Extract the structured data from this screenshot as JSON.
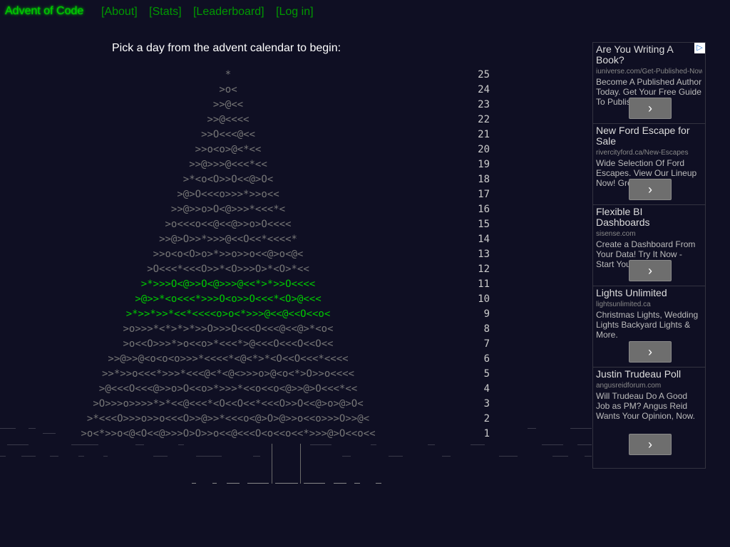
{
  "header": {
    "title": "Advent of Code",
    "nav": [
      "[About]",
      "[Stats]",
      "[Leaderboard]",
      "[Log in]"
    ]
  },
  "intro": "Pick a day from the advent calendar to begin:",
  "tree": [
    {
      "art": "*",
      "day": "25",
      "lit": false
    },
    {
      "art": ">o<",
      "day": "24",
      "lit": false
    },
    {
      "art": ">>@<<",
      "day": "23",
      "lit": false
    },
    {
      "art": ">>@<<<<",
      "day": "22",
      "lit": false
    },
    {
      "art": ">>O<<<@<<",
      "day": "21",
      "lit": false
    },
    {
      "art": ">>o<o>@<*<<",
      "day": "20",
      "lit": false
    },
    {
      "art": ">>@>>>@<<<*<<",
      "day": "19",
      "lit": false
    },
    {
      "art": ">*<o<O>>O<<@>O<",
      "day": "18",
      "lit": false
    },
    {
      "art": ">@>O<<<o>>>*>>o<<",
      "day": "17",
      "lit": false
    },
    {
      "art": ">>@>>o>O<@>>>*<<<*<",
      "day": "16",
      "lit": false
    },
    {
      "art": ">o<<<o<<@<<@>>o>O<<<<",
      "day": "15",
      "lit": false
    },
    {
      "art": ">>@>O>>*>>>@<<O<<*<<<<*",
      "day": "14",
      "lit": false
    },
    {
      "art": ">>o<o<O>o>*>>o>>o<<@>o<@<",
      "day": "13",
      "lit": false
    },
    {
      "art": ">O<<<*<<<O>>*<O>>>O>*<O>*<<",
      "day": "12",
      "lit": false
    },
    {
      "art": ">*>>>O<@>>O<@>>>@<<*>*>>O<<<<",
      "day": "11",
      "lit": true
    },
    {
      "art": ">@>>*<o<<<*>>>O<o>>O<<<*<O>@<<<",
      "day": "10",
      "lit": true
    },
    {
      "art": ">*>>*>>*<<*<<<<o>o<*>>>@<<@<<O<<o<",
      "day": "9",
      "lit": true
    },
    {
      "art": ">o>>>*<*>*>*>>O>>>O<<<O<<<@<<@>*<o<",
      "day": "8",
      "lit": false
    },
    {
      "art": ">o<<O>>>*>o<<o>*<<<*>@<<<O<<<O<<O<<",
      "day": "7",
      "lit": false
    },
    {
      "art": ">>@>>@<o<o<o>>>*<<<<*<@<*>*<O<<O<<<*<<<<",
      "day": "6",
      "lit": false
    },
    {
      "art": ">>*>>o<<<*>>>*<<<@<*<@<>>>o>@<o<*>O>>o<<<<",
      "day": "5",
      "lit": false
    },
    {
      "art": ">@<<<O<<<@>>o>O<<o>*>>>*<<o<<o<@>>@>O<<<*<<",
      "day": "4",
      "lit": false
    },
    {
      "art": ">O>>>o>>>>*>*<<@<<<*<O<<O<<*<<<O>>O<<@>o>@>O<",
      "day": "3",
      "lit": false
    },
    {
      "art": ">*<<<O>>>o>>o<<<O>>@>>*<<<o<@>O>@>>o<<o>>>O>>@<",
      "day": "2",
      "lit": false
    },
    {
      "art": ">o<*>>o<@<O<<@>>>O>O>>o<<@<<<O<o<<o<<*>>>@>O<<o<<",
      "day": "1",
      "lit": false
    }
  ],
  "ads": [
    {
      "title": "Are You Writing A Book?",
      "url": "iuniverse.com/Get-Published-Now",
      "desc": "Become A Published Author Today. Get Your Free Guide To Publishing.",
      "button": "›"
    },
    {
      "title": "New Ford Escape for Sale",
      "url": "rivercityford.ca/New-Escapes",
      "desc": "Wide Selection Of Ford Escapes. View Our Lineup Now! Great Value.",
      "button": "›"
    },
    {
      "title": "Flexible BI Dashboards",
      "url": "sisense.com",
      "desc": "Create a Dashboard From Your Data! Try It Now - Start Your Free Trial",
      "button": "›"
    },
    {
      "title": "Lights Unlimited",
      "url": "lightsunlimited.ca",
      "desc": "Christmas Lights, Wedding Lights Backyard Lights & More.",
      "button": "›"
    },
    {
      "title": "Justin Trudeau Poll",
      "url": "angusreidforum.com",
      "desc": "Will Trudeau Do A Good Job as PM? Angus Reid Wants Your Opinion, Now.",
      "button": "›"
    }
  ]
}
